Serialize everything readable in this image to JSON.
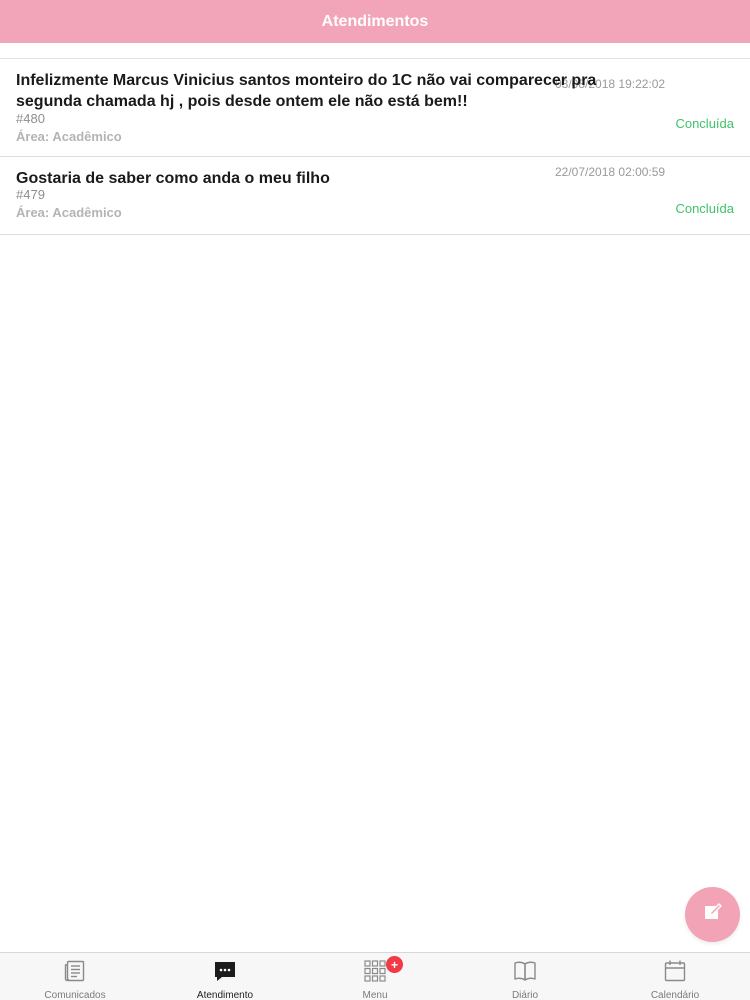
{
  "header": {
    "title": "Atendimentos"
  },
  "items": [
    {
      "title": "Infelizmente Marcus Vinicius santos monteiro do 1C não vai comparecer pra segunda chamada hj , pois desde ontem ele não está bem!!",
      "date": "03/08/2018 19:22:02",
      "id": "#480",
      "area": "Área: Acadêmico",
      "status": "Concluída"
    },
    {
      "title": "Gostaria de saber como anda o meu filho",
      "date": "22/07/2018 02:00:59",
      "id": "#479",
      "area": "Área: Acadêmico",
      "status": "Concluída"
    }
  ],
  "fab": {
    "icon": "compose-icon"
  },
  "tabbar": {
    "tabs": [
      {
        "label": "Comunicados",
        "icon": "newspaper-icon",
        "active": false
      },
      {
        "label": "Atendimento",
        "icon": "chat-icon",
        "active": true
      },
      {
        "label": "Menu",
        "icon": "grid-icon",
        "active": false,
        "badge": "+"
      },
      {
        "label": "Diário",
        "icon": "book-icon",
        "active": false
      },
      {
        "label": "Calendário",
        "icon": "calendar-icon",
        "active": false
      }
    ]
  },
  "colors": {
    "header": "#f2a5b8",
    "status": "#3fc26b",
    "fab": "#f3a3b6",
    "badge": "#f03a46"
  }
}
